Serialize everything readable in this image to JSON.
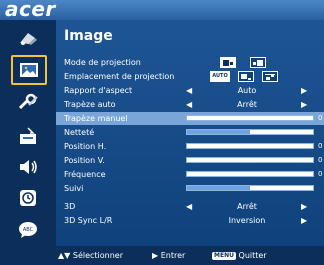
{
  "brand": {
    "logo_text": "acer"
  },
  "sidebar": {
    "items": [
      {
        "name": "color-icon"
      },
      {
        "name": "image-icon",
        "active": true
      },
      {
        "name": "settings-icon"
      },
      {
        "name": "management-icon"
      },
      {
        "name": "audio-icon"
      },
      {
        "name": "timer-icon"
      },
      {
        "name": "language-icon"
      }
    ]
  },
  "main": {
    "title": "Image",
    "rows": {
      "mode_projection": {
        "label": "Mode de projection"
      },
      "emplacement": {
        "label": "Emplacement de projection",
        "auto_label": "AUTO"
      },
      "rapport_aspect": {
        "label": "Rapport d'aspect",
        "value": "Auto"
      },
      "trapeze_auto": {
        "label": "Trapèze auto",
        "value": "Arrêt"
      },
      "trapeze_manuel": {
        "label": "Trapèze manuel",
        "level": 0
      },
      "nettete": {
        "label": "Netteté",
        "level": 0.5
      },
      "position_h": {
        "label": "Position H.",
        "level": 0
      },
      "position_v": {
        "label": "Position V.",
        "level": 0
      },
      "frequence": {
        "label": "Fréquence",
        "level": 0
      },
      "suivi": {
        "label": "Suivi",
        "level": 0.5
      },
      "mode_3d": {
        "label": "3D",
        "value": "Arrêt"
      },
      "sync_3d": {
        "label": "3D Sync L/R",
        "value": "Inversion"
      }
    }
  },
  "footer": {
    "select_label": "Sélectionner",
    "enter_label": "Entrer",
    "menu_key": "MENU",
    "quit_label": "Quitter"
  },
  "colors": {
    "accent": "#f2c531",
    "bar_fill": "#6ea3df",
    "highlight": "#7aa5d8",
    "background": "#0b3f7a"
  }
}
